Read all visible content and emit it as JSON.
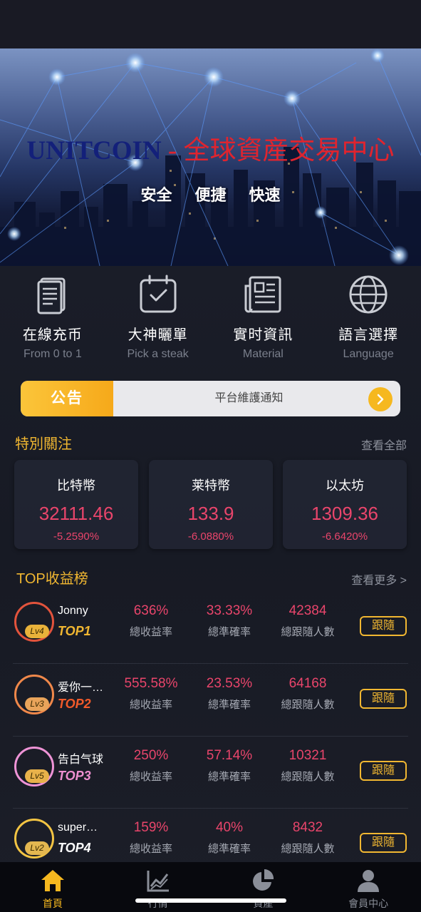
{
  "banner": {
    "brand": "UNITCOIN",
    "separator": " - ",
    "title_cn": "全球資産交易中心",
    "tags": [
      "安全",
      "便捷",
      "快速"
    ]
  },
  "features": [
    {
      "label": "在線充币",
      "sub": "From 0 to 1",
      "icon": "document-icon"
    },
    {
      "label": "大神曬單",
      "sub": "Pick a steak",
      "icon": "calendar-check-icon"
    },
    {
      "label": "實时資訊",
      "sub": "Material",
      "icon": "newspaper-icon"
    },
    {
      "label": "語言選擇",
      "sub": "Language",
      "icon": "globe-icon"
    }
  ],
  "notice": {
    "tag": "公告",
    "text": "平台維護通知"
  },
  "watchlist": {
    "title": "特別關注",
    "more": "查看全部",
    "coins": [
      {
        "name": "比特幣",
        "price": "32111.46",
        "change": "-5.2590%"
      },
      {
        "name": "莱特幣",
        "price": "133.9",
        "change": "-6.0880%"
      },
      {
        "name": "以太坊",
        "price": "1309.36",
        "change": "-6.6420%"
      }
    ]
  },
  "leaderboard": {
    "title": "TOP收益榜",
    "more": "查看更多 >",
    "stat_labels": [
      "總收益率",
      "總準確率",
      "總跟隨人數"
    ],
    "follow_label": "跟隨",
    "rows": [
      {
        "name": "Jonny",
        "level": "Lv4",
        "rank": "TOP1",
        "profit": "636%",
        "accuracy": "33.33%",
        "followers": "42384",
        "ring_color": "#e2533c",
        "rank_color": "#f1b731"
      },
      {
        "name": "爱你一…",
        "level": "Lv3",
        "rank": "TOP2",
        "profit": "555.58%",
        "accuracy": "23.53%",
        "followers": "64168",
        "ring_color": "#f0884a",
        "rank_color": "#f05a2a"
      },
      {
        "name": "告白气球",
        "level": "Lv5",
        "rank": "TOP3",
        "profit": "250%",
        "accuracy": "57.14%",
        "followers": "10321",
        "ring_color": "#ee93d6",
        "rank_color": "#ee8fd0"
      },
      {
        "name": "super…",
        "level": "Lv2",
        "rank": "TOP4",
        "profit": "159%",
        "accuracy": "40%",
        "followers": "8432",
        "ring_color": "#f3c443",
        "rank_color": "#ffffff"
      }
    ]
  },
  "tabs": [
    {
      "label": "首頁",
      "icon": "home-icon",
      "active": true
    },
    {
      "label": "行情",
      "icon": "chart-icon",
      "active": false
    },
    {
      "label": "資產",
      "icon": "pie-chart-icon",
      "active": false
    },
    {
      "label": "會員中心",
      "icon": "user-icon",
      "active": false
    }
  ]
}
